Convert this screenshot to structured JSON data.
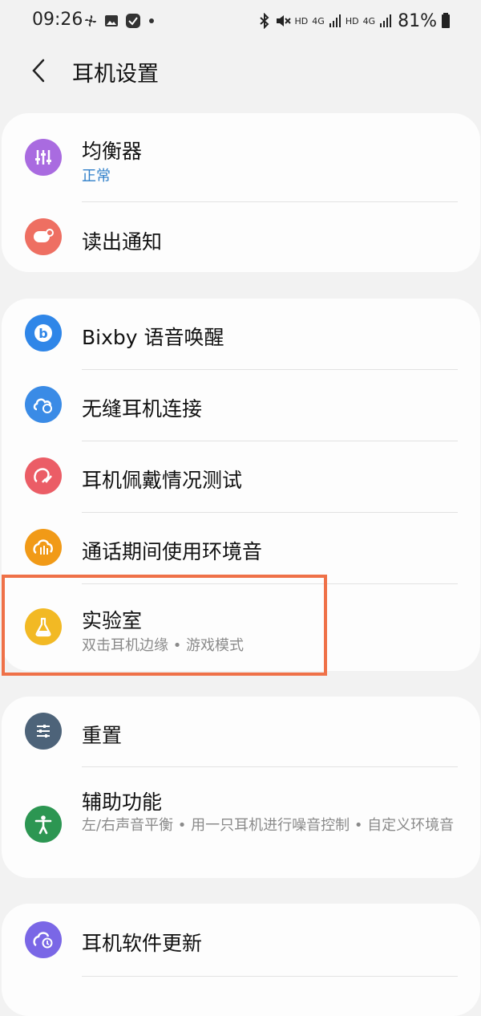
{
  "status_bar": {
    "time": "09:26",
    "left_icons": [
      "fan-icon",
      "gallery-icon",
      "check-app-icon",
      "dot-icon"
    ],
    "right_icons": [
      "bluetooth-icon",
      "mute-icon",
      "signal-hd-4g-icon",
      "signal-hd-4g-icon",
      "battery-icon"
    ],
    "hd_label": "HD",
    "net_label": "4G",
    "battery": "81%"
  },
  "header": {
    "title": "耳机设置"
  },
  "cards": {
    "eq": {
      "title": "均衡器",
      "subtitle": "正常"
    },
    "read_notify": {
      "title": "读出通知"
    },
    "bixby": {
      "title": "Bixby 语音唤醒"
    },
    "seamless": {
      "title": "无缝耳机连接"
    },
    "fit_test": {
      "title": "耳机佩戴情况测试"
    },
    "ambient": {
      "title": "通话期间使用环境音"
    },
    "labs": {
      "title": "实验室",
      "subtitle": "双击耳机边缘 • 游戏模式"
    },
    "reset": {
      "title": "重置"
    },
    "accessibility": {
      "title": "辅助功能",
      "subtitle": "左/右声音平衡 • 用一只耳机进行噪音控制 • 自定义环境音"
    },
    "update": {
      "title": "耳机软件更新"
    }
  },
  "colors": {
    "eq": "#a96be0",
    "read_notify": "#ee6f62",
    "bixby": "#2f86e8",
    "seamless": "#3a8be6",
    "fit_test": "#eb5d66",
    "ambient": "#f19a17",
    "labs": "#f2b924",
    "reset": "#4d6379",
    "accessibility": "#2c9652",
    "update": "#7a67e6",
    "highlight": "#ef7148",
    "subtitle_accent": "#2f7fc9"
  }
}
